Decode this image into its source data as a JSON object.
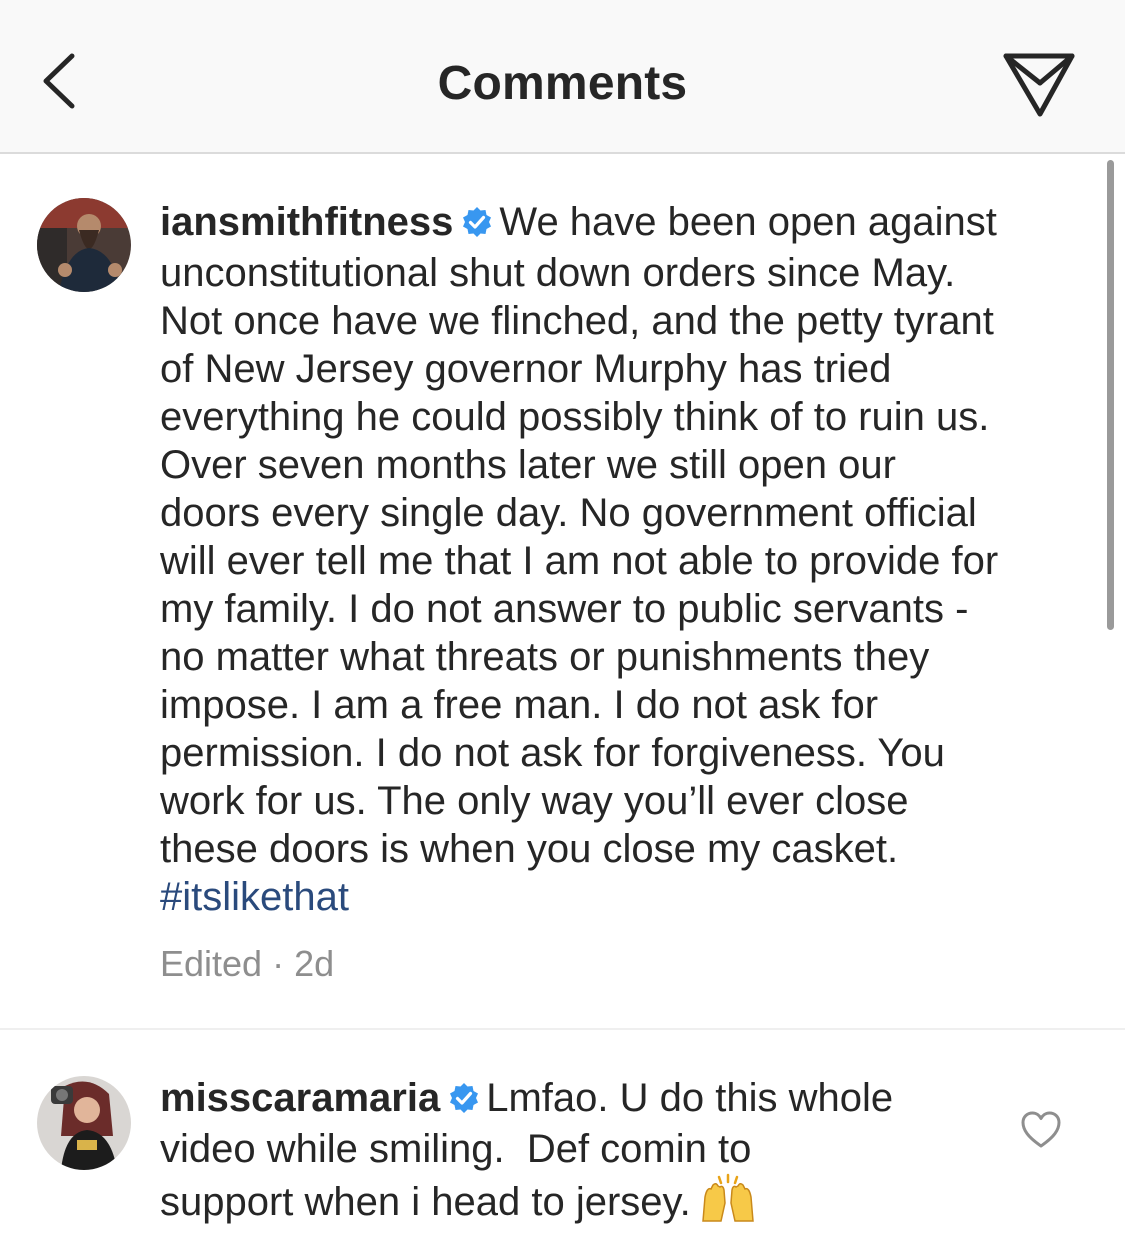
{
  "header": {
    "title": "Comments",
    "back_icon": "chevron-left-icon",
    "share_icon": "paper-plane-icon"
  },
  "comments": [
    {
      "username": "iansmithfitness",
      "verified": true,
      "text_lines": [
        "We have been open against",
        "unconstitutional shut down orders since May.",
        "Not once have we flinched, and the petty tyrant",
        "of New Jersey governor Murphy has tried",
        "everything he could possibly think of to ruin us.",
        "Over seven months later we still open our",
        "doors every single day. No government official",
        "will ever tell me that I am not able to provide for",
        "my family. I do not answer to public servants -",
        "no matter what threats or punishments they",
        "impose. I am a free man. I do not ask for",
        "permission. I do not ask for forgiveness. You",
        "work for us. The only way you’ll ever close",
        "these doors is when you close my casket."
      ],
      "hashtag": "#itslikethat",
      "edited_label": "Edited",
      "separator": "·",
      "time": "2d"
    },
    {
      "username": "misscaramaria",
      "verified": true,
      "text_lines": [
        "Lmfao. U do this whole",
        "video while smiling.  Def comin to",
        "support when i head to jersey."
      ],
      "emoji": "raising-hands-emoji",
      "like_icon": "heart-outline-icon"
    }
  ],
  "colors": {
    "text": "#262626",
    "secondary": "#8e8e8e",
    "hashtag": "#2a4a7c",
    "verified": "#3897f0",
    "header_bg": "#f9f9f9"
  }
}
